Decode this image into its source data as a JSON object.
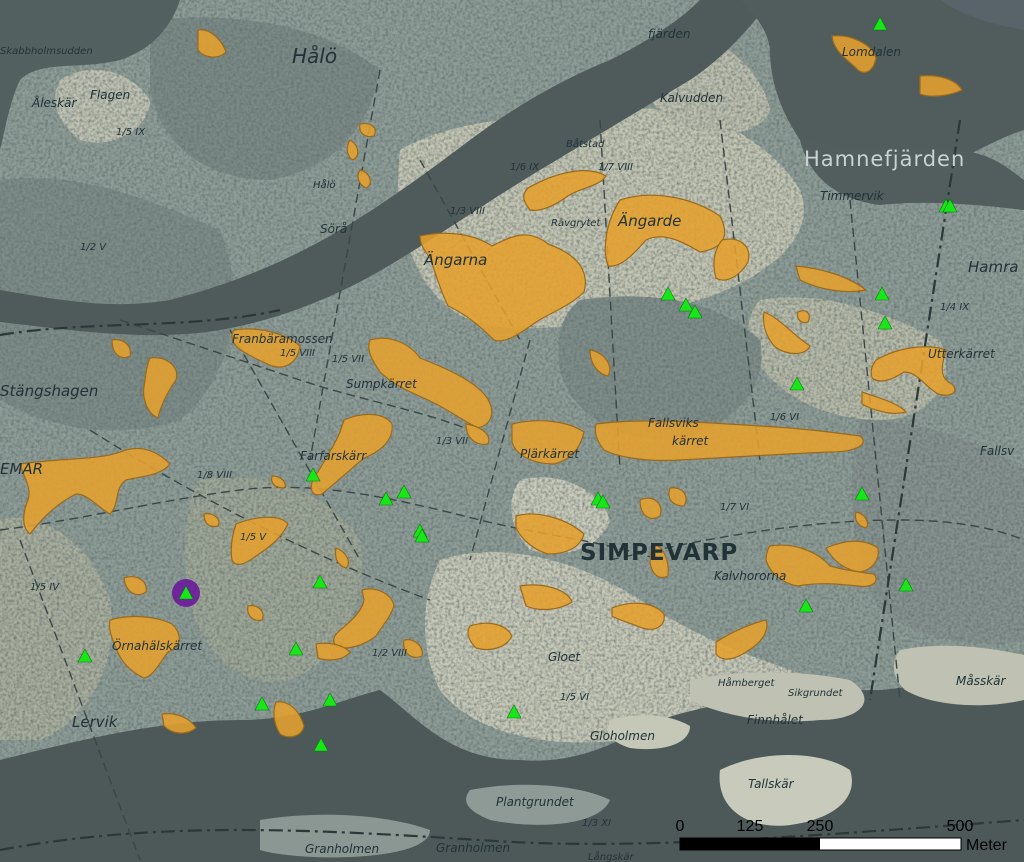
{
  "map": {
    "colors": {
      "water": "#4f5b5b",
      "land": "#8f9d98",
      "land_light": "#c9cbbb",
      "wetland": "#e5a12e",
      "wetland_stroke": "#9a6a1c",
      "site_marker": "#19e619",
      "highlight_ring": "#6a1b9a"
    },
    "place_names": [
      {
        "id": "halo",
        "text": "Hålö"
      },
      {
        "id": "skabbholmsudden",
        "text": "Skabbholmsudden"
      },
      {
        "id": "aleskar",
        "text": "Åleskär"
      },
      {
        "id": "flagen",
        "text": "Flagen"
      },
      {
        "id": "halo-small",
        "text": "Hålö"
      },
      {
        "id": "sora",
        "text": "Sörå"
      },
      {
        "id": "fjarden",
        "text": "fjärden"
      },
      {
        "id": "lomdalen",
        "text": "Lomdalen"
      },
      {
        "id": "kalvudden",
        "text": "Kalvudden"
      },
      {
        "id": "batstad",
        "text": "Båtstad"
      },
      {
        "id": "hamnefjarden",
        "text": "Hamnefjärden"
      },
      {
        "id": "timmervik",
        "text": "Timmervik"
      },
      {
        "id": "ravgrytet",
        "text": "Rävgrytet"
      },
      {
        "id": "angarde",
        "text": "Ängarde"
      },
      {
        "id": "angarna",
        "text": "Ängarna"
      },
      {
        "id": "hamra",
        "text": "Hamra"
      },
      {
        "id": "franbaramossen",
        "text": "Franbäramossen"
      },
      {
        "id": "sumpkarret",
        "text": "Sumpkärret"
      },
      {
        "id": "stangshagen",
        "text": "Stängshagen"
      },
      {
        "id": "utterkarret",
        "text": "Utterkärret"
      },
      {
        "id": "fallsviks",
        "text": "Fallsviks"
      },
      {
        "id": "karret",
        "text": "kärret"
      },
      {
        "id": "farfarskarr",
        "text": "Farfarskärr"
      },
      {
        "id": "plarkarret",
        "text": "Plärkärret"
      },
      {
        "id": "simpevarp",
        "text": "SIMPEVARP"
      },
      {
        "id": "kalvhororna",
        "text": "Kalvhororna"
      },
      {
        "id": "ornahalskarret",
        "text": "Örnahälskärret"
      },
      {
        "id": "lervik",
        "text": "Lervik"
      },
      {
        "id": "gloet",
        "text": "Gloet"
      },
      {
        "id": "hamberget",
        "text": "Håmberget"
      },
      {
        "id": "sikgrundet",
        "text": "Sikgrundet"
      },
      {
        "id": "finnhalet",
        "text": "Finnhålet"
      },
      {
        "id": "masskar",
        "text": "Måsskär"
      },
      {
        "id": "gloholmen",
        "text": "Gloholmen"
      },
      {
        "id": "tallskar",
        "text": "Tallskär"
      },
      {
        "id": "plantgrundet",
        "text": "Plantgrundet"
      },
      {
        "id": "granholmen-1",
        "text": "Granholmen"
      },
      {
        "id": "granholmen-2",
        "text": "Granholmen"
      },
      {
        "id": "langskar",
        "text": "Långskär"
      },
      {
        "id": "emar",
        "text": "EMAR"
      },
      {
        "id": "fallsv",
        "text": "Fallsv"
      }
    ],
    "grid_codes": [
      {
        "text": "1/2 V"
      },
      {
        "text": "1/5 IX"
      },
      {
        "text": "1/3 VIII"
      },
      {
        "text": "1/6 IX"
      },
      {
        "text": "1/7 VIII"
      },
      {
        "text": "1/5 VIII"
      },
      {
        "text": "1/8 VIII"
      },
      {
        "text": "1/5 VII"
      },
      {
        "text": "1/3 VII"
      },
      {
        "text": "1/5 IV"
      },
      {
        "text": "1/7 VI"
      },
      {
        "text": "1/6 VI"
      },
      {
        "text": "1/5 V"
      },
      {
        "text": "1/2 VIII"
      },
      {
        "text": "1/5 VI"
      },
      {
        "text": "1/3 XI"
      },
      {
        "text": "1/4 IX"
      }
    ],
    "scale_bar": {
      "ticks": [
        "0",
        "125",
        "250",
        "500"
      ],
      "unit": "Meter"
    }
  }
}
